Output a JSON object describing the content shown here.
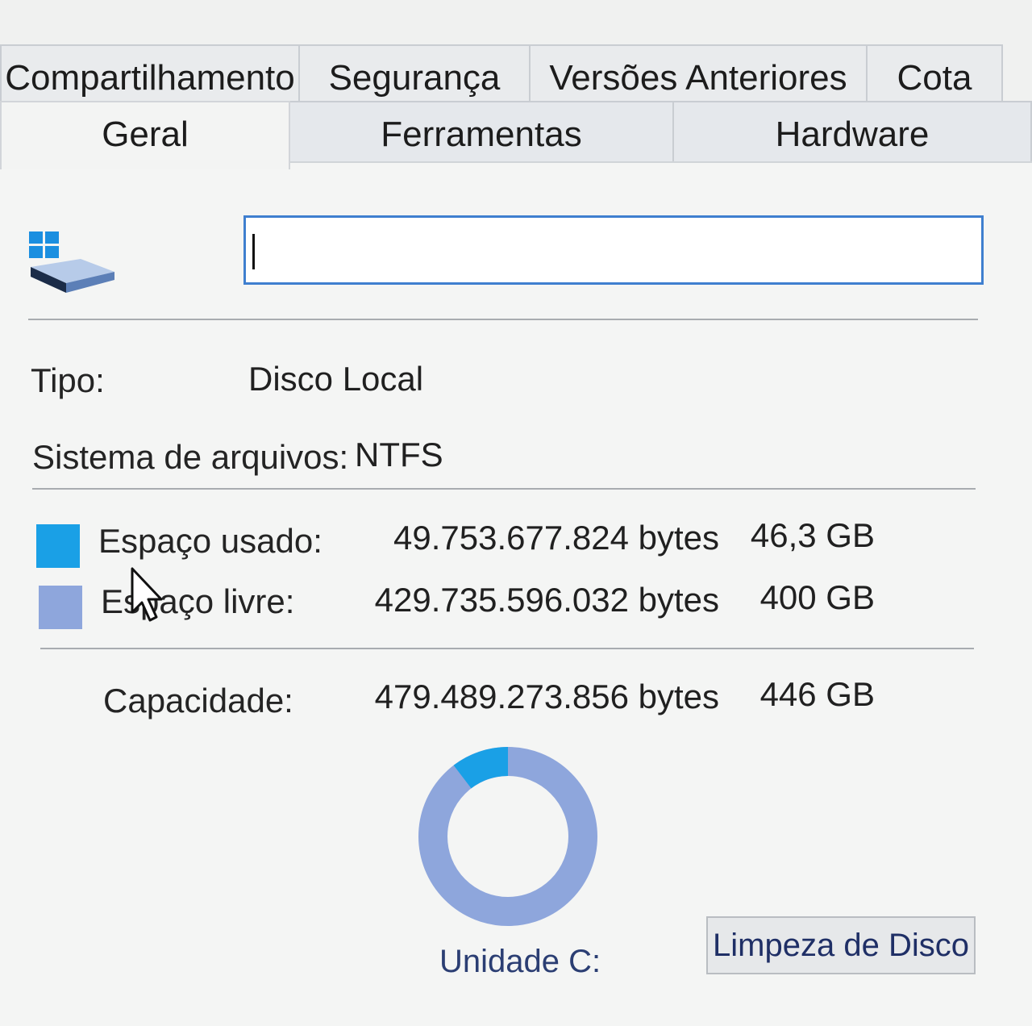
{
  "tabs": {
    "row1": [
      "Compartilhamento",
      "Segurança",
      "Versões Anteriores",
      "Cota"
    ],
    "row2": [
      "Geral",
      "Ferramentas",
      "Hardware"
    ],
    "active": "Geral"
  },
  "name_field": {
    "value": ""
  },
  "info": {
    "type_label": "Tipo:",
    "type_value": "Disco Local",
    "fs_label": "Sistema de arquivos:",
    "fs_value": "NTFS"
  },
  "space": {
    "used_label": "Espaço usado:",
    "used_bytes": "49.753.677.824 bytes",
    "used_gb": "46,3 GB",
    "free_label": "Espaço livre:",
    "free_bytes": "429.735.596.032 bytes",
    "free_gb": "400 GB",
    "capacity_label": "Capacidade:",
    "capacity_bytes": "479.489.273.856 bytes",
    "capacity_gb": "446 GB",
    "used_fraction": 0.1038
  },
  "colors": {
    "used": "#1aa0e6",
    "free": "#8ea6dc",
    "accent": "#3f7fcf"
  },
  "drive_label": "Unidade C:",
  "cleanup_button": "Limpeza de Disco",
  "icons": {
    "drive": "windows-drive-icon",
    "pointer": "mouse-pointer-icon"
  }
}
